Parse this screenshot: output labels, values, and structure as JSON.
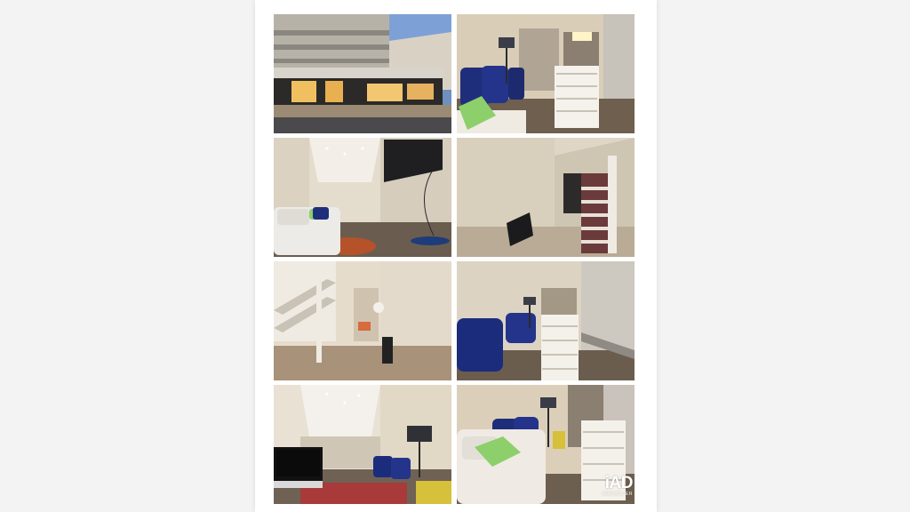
{
  "page": {
    "background": "#f3f3f3",
    "sheet_color": "#ffffff"
  },
  "photos": [
    {
      "subject": "building-exterior-street"
    },
    {
      "subject": "lounge-armchairs-staircase"
    },
    {
      "subject": "sofa-tv-wall"
    },
    {
      "subject": "staircase-hallway"
    },
    {
      "subject": "under-stairs-corridor"
    },
    {
      "subject": "blue-armchairs-lamp"
    },
    {
      "subject": "computer-desk-lounge"
    },
    {
      "subject": "sofa-green-pillow-lounge"
    }
  ],
  "watermark": {
    "mark": "iAD",
    "sub": "IMMOBILIER"
  }
}
